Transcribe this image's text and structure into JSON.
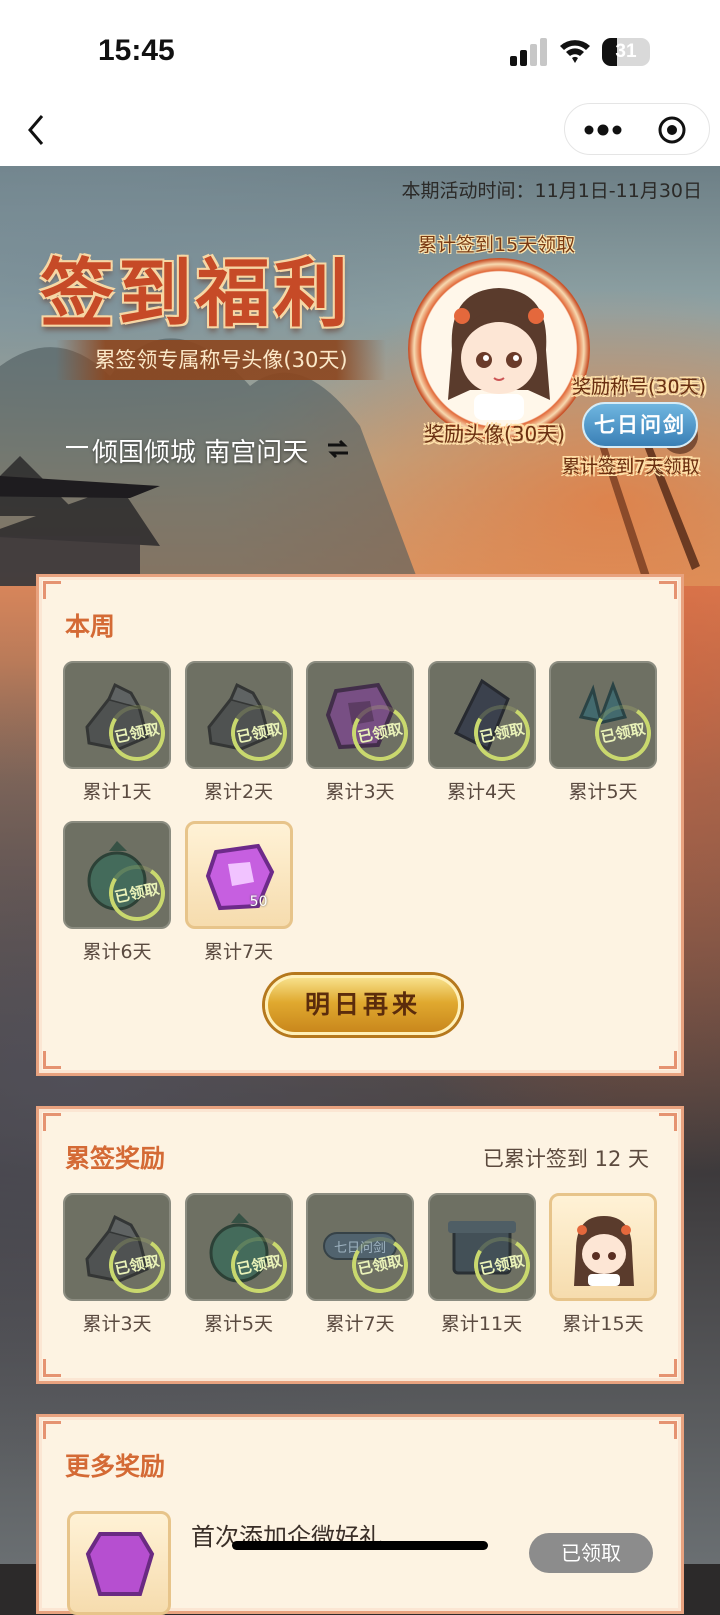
{
  "status": {
    "time": "15:45",
    "battery": "31",
    "battery_level": 0.31
  },
  "hero": {
    "period": "本期活动时间：11月1日-11月30日",
    "title": "签到福利",
    "subtitle": "累签领专属称号头像(30天)",
    "names": "倾国倾城 南宫问天",
    "avatar_caption": "累计签到15天领取",
    "avatar_tag": "奖励头像(30天)",
    "title_tag": "奖励称号(30天)",
    "title_badge": "七日问剑",
    "title_caption": "累计签到7天领取"
  },
  "weekly": {
    "title": "本周",
    "items": [
      {
        "label": "累计1天",
        "stamp": "已领取",
        "icon": "fragment-icon"
      },
      {
        "label": "累计2天",
        "stamp": "已领取",
        "icon": "fragment-icon"
      },
      {
        "label": "累计3天",
        "stamp": "已领取",
        "icon": "purple-jade-icon"
      },
      {
        "label": "累计4天",
        "stamp": "已领取",
        "icon": "dark-crystal-icon"
      },
      {
        "label": "累计5天",
        "stamp": "已领取",
        "icon": "teal-crystal-icon"
      },
      {
        "label": "累计6天",
        "stamp": "已领取",
        "icon": "green-pouch-icon"
      },
      {
        "label": "累计7天",
        "qty": "50",
        "icon": "purple-jade-icon"
      }
    ],
    "button": "明日再来"
  },
  "cumulative": {
    "title": "累签奖励",
    "count_text": "已累计签到 12 天",
    "items": [
      {
        "label": "累计3天",
        "stamp": "已领取",
        "icon": "fragment-icon"
      },
      {
        "label": "累计5天",
        "stamp": "已领取",
        "icon": "green-pouch-icon"
      },
      {
        "label": "累计7天",
        "stamp": "已领取",
        "icon": "title-badge-icon",
        "inner": "七日问剑"
      },
      {
        "label": "累计11天",
        "stamp": "已领取",
        "icon": "box-icon"
      },
      {
        "label": "累计15天",
        "icon": "avatar-icon"
      }
    ]
  },
  "more": {
    "title": "更多奖励",
    "row_text": "首次添加企微好礼",
    "row_button": "已领取"
  },
  "colors": {
    "accent": "#d46a35",
    "card_bg": "#fdf3e2",
    "card_border": "#e8a27f",
    "gold": "#e0a92f"
  }
}
